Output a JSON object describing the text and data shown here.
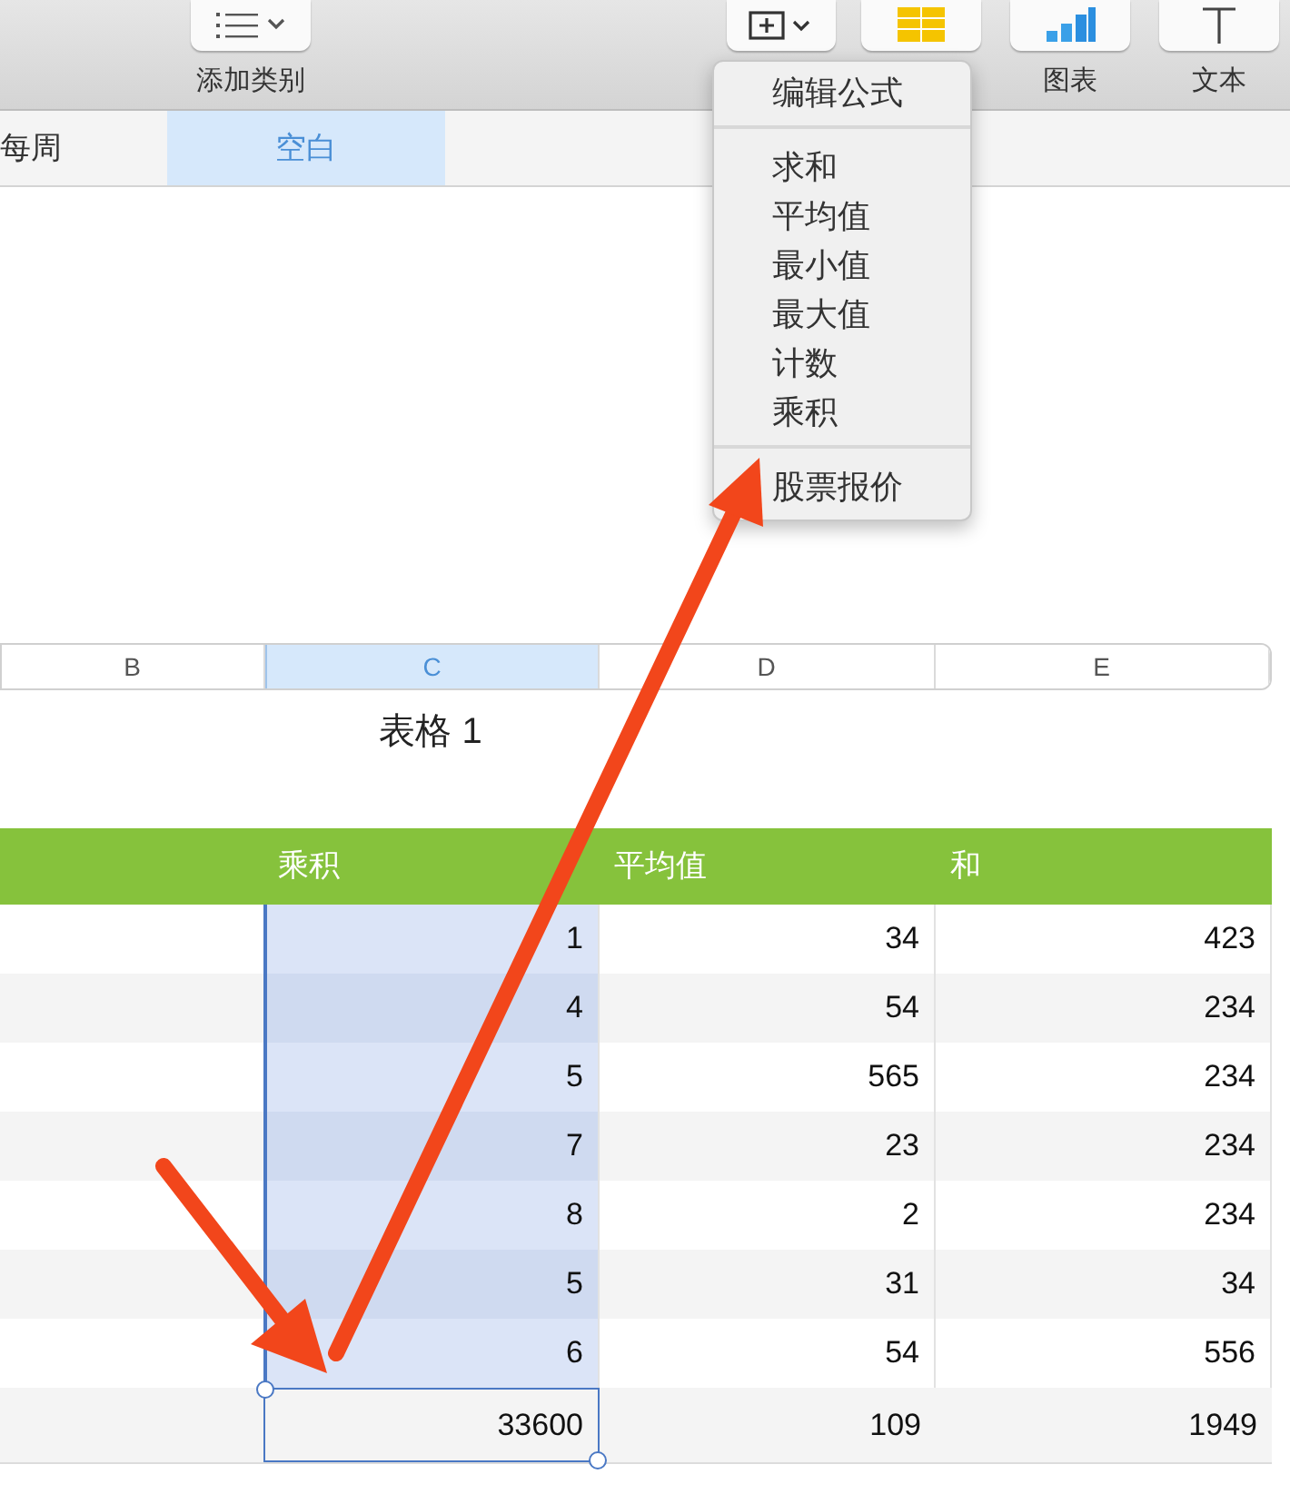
{
  "toolbar": {
    "buttons": [
      {
        "kind": "list",
        "label": "添加类别"
      },
      {
        "kind": "function"
      },
      {
        "kind": "table"
      },
      {
        "kind": "chart",
        "label": "图表"
      },
      {
        "kind": "text",
        "label": "文本"
      }
    ]
  },
  "sheet_tabs": [
    {
      "label": "每周",
      "selected": false
    },
    {
      "label": "空白",
      "selected": true
    }
  ],
  "function_menu": {
    "groups": [
      [
        "编辑公式"
      ],
      [
        "求和",
        "平均值",
        "最小值",
        "最大值",
        "计数",
        "乘积"
      ],
      [
        "股票报价"
      ]
    ]
  },
  "columns": [
    {
      "label": "B",
      "selected": false
    },
    {
      "label": "C",
      "selected": true
    },
    {
      "label": "D",
      "selected": false
    },
    {
      "label": "E",
      "selected": false
    }
  ],
  "table": {
    "title": "表格 1",
    "headers": [
      "乘积",
      "平均值",
      "和"
    ],
    "rows": [
      [
        "1",
        "34",
        "423"
      ],
      [
        "4",
        "54",
        "234"
      ],
      [
        "5",
        "565",
        "234"
      ],
      [
        "7",
        "23",
        "234"
      ],
      [
        "8",
        "2",
        "234"
      ],
      [
        "5",
        "31",
        "34"
      ],
      [
        "6",
        "54",
        "556"
      ]
    ],
    "footer": [
      {
        "text": "33600",
        "selected": true
      },
      {
        "text": "109",
        "selected": false
      },
      {
        "text": "1949",
        "selected": false
      }
    ]
  }
}
